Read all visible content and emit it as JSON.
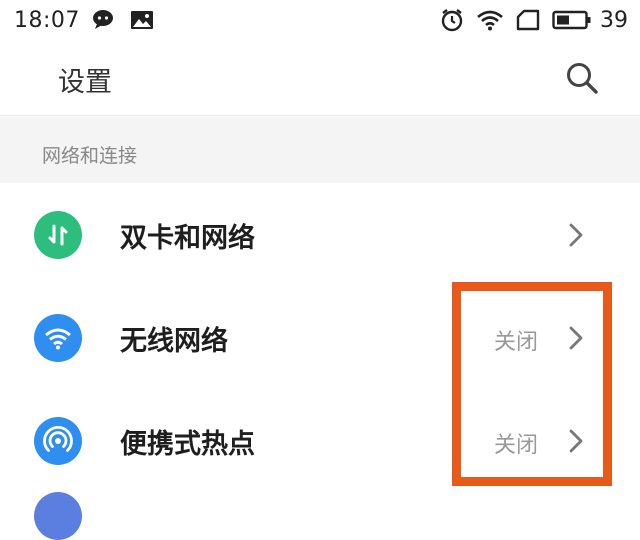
{
  "status_bar": {
    "time": "18:07",
    "battery": "39",
    "icons": [
      "wechat-icon",
      "gallery-icon",
      "alarm-icon",
      "wifi-icon",
      "sim-icon",
      "battery-icon"
    ]
  },
  "header": {
    "title": "设置",
    "search_icon": "search-icon"
  },
  "section": {
    "title": "网络和连接"
  },
  "items": [
    {
      "label": "双卡和网络",
      "status": "",
      "icon": "dual-sim-icon",
      "color": "#2dbe7e"
    },
    {
      "label": "无线网络",
      "status": "关闭",
      "icon": "wifi-icon",
      "color": "#2f8ff0"
    },
    {
      "label": "便携式热点",
      "status": "关闭",
      "icon": "hotspot-icon",
      "color": "#2f8ff0"
    }
  ],
  "colors": {
    "highlight": "#e85a1b",
    "section_bg": "#f4f4f4",
    "partial_icon": "#5b7fe0"
  }
}
